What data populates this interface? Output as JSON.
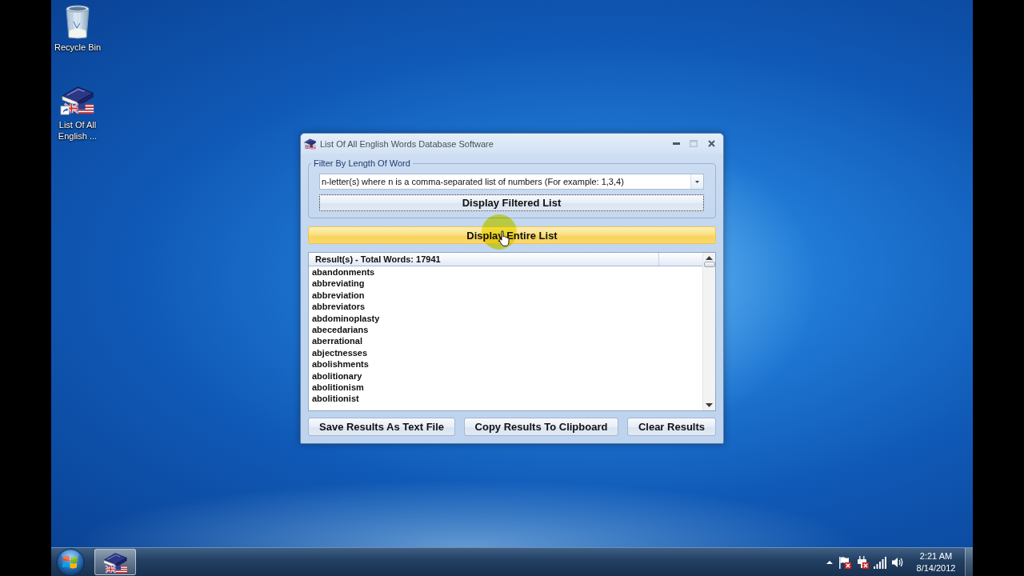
{
  "desktop": {
    "icons": [
      {
        "kind": "recycle_bin",
        "label": "Recycle Bin"
      },
      {
        "kind": "app_shortcut",
        "label": "List Of All English ..."
      }
    ]
  },
  "window": {
    "title": "List Of All English Words Database Software",
    "controls": [
      {
        "kind": "minimize",
        "disabled": false
      },
      {
        "kind": "maximize",
        "disabled": true
      },
      {
        "kind": "close",
        "disabled": false
      }
    ],
    "filter_group": {
      "legend": "Filter By Length Of Word",
      "combo": {
        "value": "n-letter(s) where n is a comma-separated list of numbers (For example: 1,3,4)"
      },
      "button": {
        "label": "Display Filtered List",
        "focused": true,
        "hovered": false
      }
    },
    "entire_list_button": {
      "label": "Display Entire List",
      "focused": false,
      "hovered": true
    },
    "results": {
      "header": "Result(s) - Total Words: 17941",
      "rows": [
        "abandonments",
        "abbreviating",
        "abbreviation",
        "abbreviators",
        "abdominoplasty",
        "abecedarians",
        "aberrational",
        "abjectnesses",
        "abolishments",
        "abolitionary",
        "abolitionism",
        "abolitionist"
      ]
    },
    "actions": [
      "Save Results As Text File",
      "Copy Results To Clipboard",
      "Clear Results"
    ]
  },
  "taskbar": {
    "items": [
      {
        "kind": "app",
        "selected": true
      }
    ],
    "tray": {
      "icons": [
        {
          "kind": "show_hidden",
          "alert": false
        },
        {
          "kind": "action_center",
          "alert": true
        },
        {
          "kind": "power",
          "alert": true
        },
        {
          "kind": "network",
          "alert": false
        },
        {
          "kind": "volume",
          "alert": false
        }
      ],
      "time": "2:21 AM",
      "date": "8/14/2012"
    }
  }
}
